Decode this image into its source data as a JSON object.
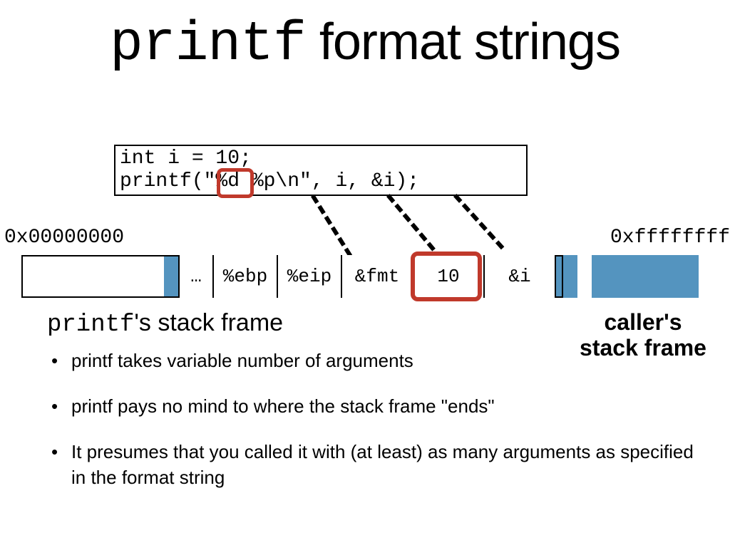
{
  "title": {
    "mono": "printf",
    "rest": " format strings"
  },
  "code": {
    "line1": "int i = 10;",
    "line2": "printf(\"%d %p\\n\", i, &i);"
  },
  "addr": {
    "left": "0x00000000",
    "right": "0xffffffff"
  },
  "cells": {
    "dots": "…",
    "ebp": "%ebp",
    "eip": "%eip",
    "fmt": "&fmt",
    "ten": "10",
    "refi": "&i"
  },
  "labels": {
    "printf_frame_mono": "printf",
    "printf_frame_rest": "'s stack frame",
    "caller_line1": "caller's",
    "caller_line2": "stack frame"
  },
  "bullets": {
    "b1": "printf takes variable number of arguments",
    "b2": "printf pays no mind to where the stack frame \"ends\"",
    "b3": "It presumes that you called it with (at least) as many arguments as specified in the format string"
  }
}
